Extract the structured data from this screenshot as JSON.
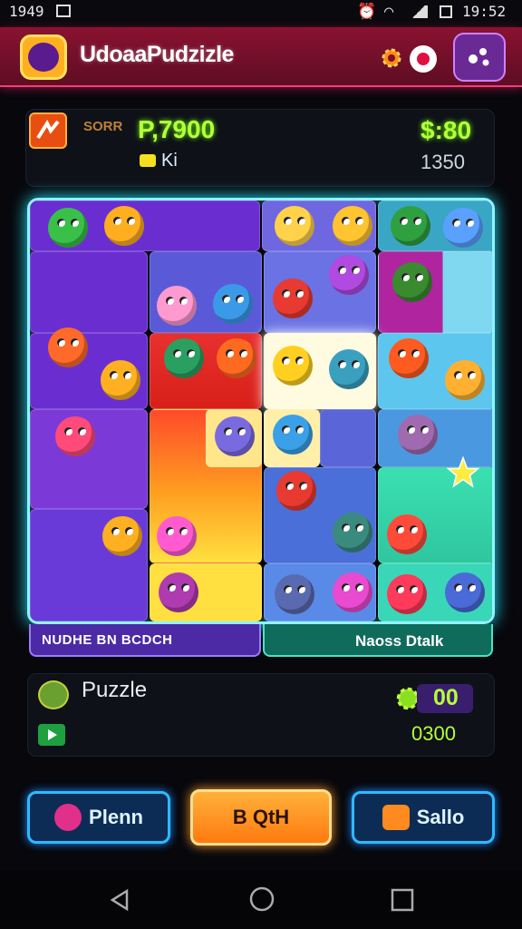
{
  "status_bar": {
    "left_time": "1949",
    "right_time": "19:52"
  },
  "header": {
    "title": "UdoaaPudzizle"
  },
  "stats": {
    "label": "SORR",
    "score": "P,7900",
    "sub_label": "Ki",
    "money": "$:80",
    "count": "1350"
  },
  "board": {
    "left_caption": "NUDHE BN BCDCH",
    "right_caption": "Naoss Dtalk"
  },
  "info": {
    "title": "Puzzle",
    "badge_value": "00",
    "value": "0300"
  },
  "buttons": {
    "play_label": "Plenn",
    "center_label": "B QtH",
    "sale_label": "Sallo"
  },
  "colors": {
    "accent": "#25e8ff",
    "header": "#7a1030",
    "score_green": "#b6ff3a",
    "button_orange": "#ff9a20"
  }
}
